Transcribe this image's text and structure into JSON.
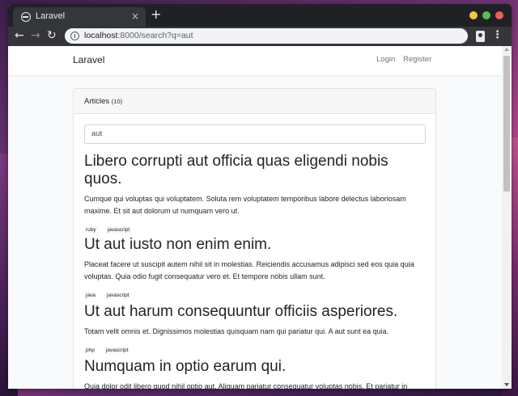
{
  "browser": {
    "tab_title": "Laravel",
    "tab_close": "×",
    "new_tab": "+",
    "back": "←",
    "forward": "→",
    "reload": "↻",
    "url_host": "localhost",
    "url_rest": ":8000/search?q=aut",
    "menu": "⋮"
  },
  "navbar": {
    "brand": "Laravel",
    "login": "Login",
    "register": "Register"
  },
  "card": {
    "title": "Articles",
    "count": "(10)"
  },
  "search": {
    "value": "aut"
  },
  "articles": [
    {
      "title": "Libero corrupti aut officia quas eligendi nobis quos.",
      "body": "Cumque qui voluptas qui voluptatem. Soluta rem voluptatem temporibus labore delectus laboriosam maxime. Et sit aut dolorum ut numquam vero ut.",
      "tags": [
        "ruby",
        "javascript"
      ]
    },
    {
      "title": "Ut aut iusto non enim enim.",
      "body": "Placeat facere ut suscipit autem nihil sit in molestias. Reiciendis accusamus adipisci sed eos quia quia voluptas. Quia odio fugit consequatur vero et. Et tempore nobis ullam sunt.",
      "tags": [
        "java",
        "javascript"
      ]
    },
    {
      "title": "Ut aut harum consequuntur officiis asperiores.",
      "body": "Totam velit omnis et. Dignissimos molestias quisquam nam qui pariatur qui. A aut sunt ea quia.",
      "tags": [
        "php",
        "javascript"
      ]
    },
    {
      "title": "Numquam in optio earum qui.",
      "body": "Quia dolor odit libero quod nihil optio aut. Aliquam pariatur consequatur voluptas nobis. Et pariatur in",
      "tags": []
    }
  ]
}
